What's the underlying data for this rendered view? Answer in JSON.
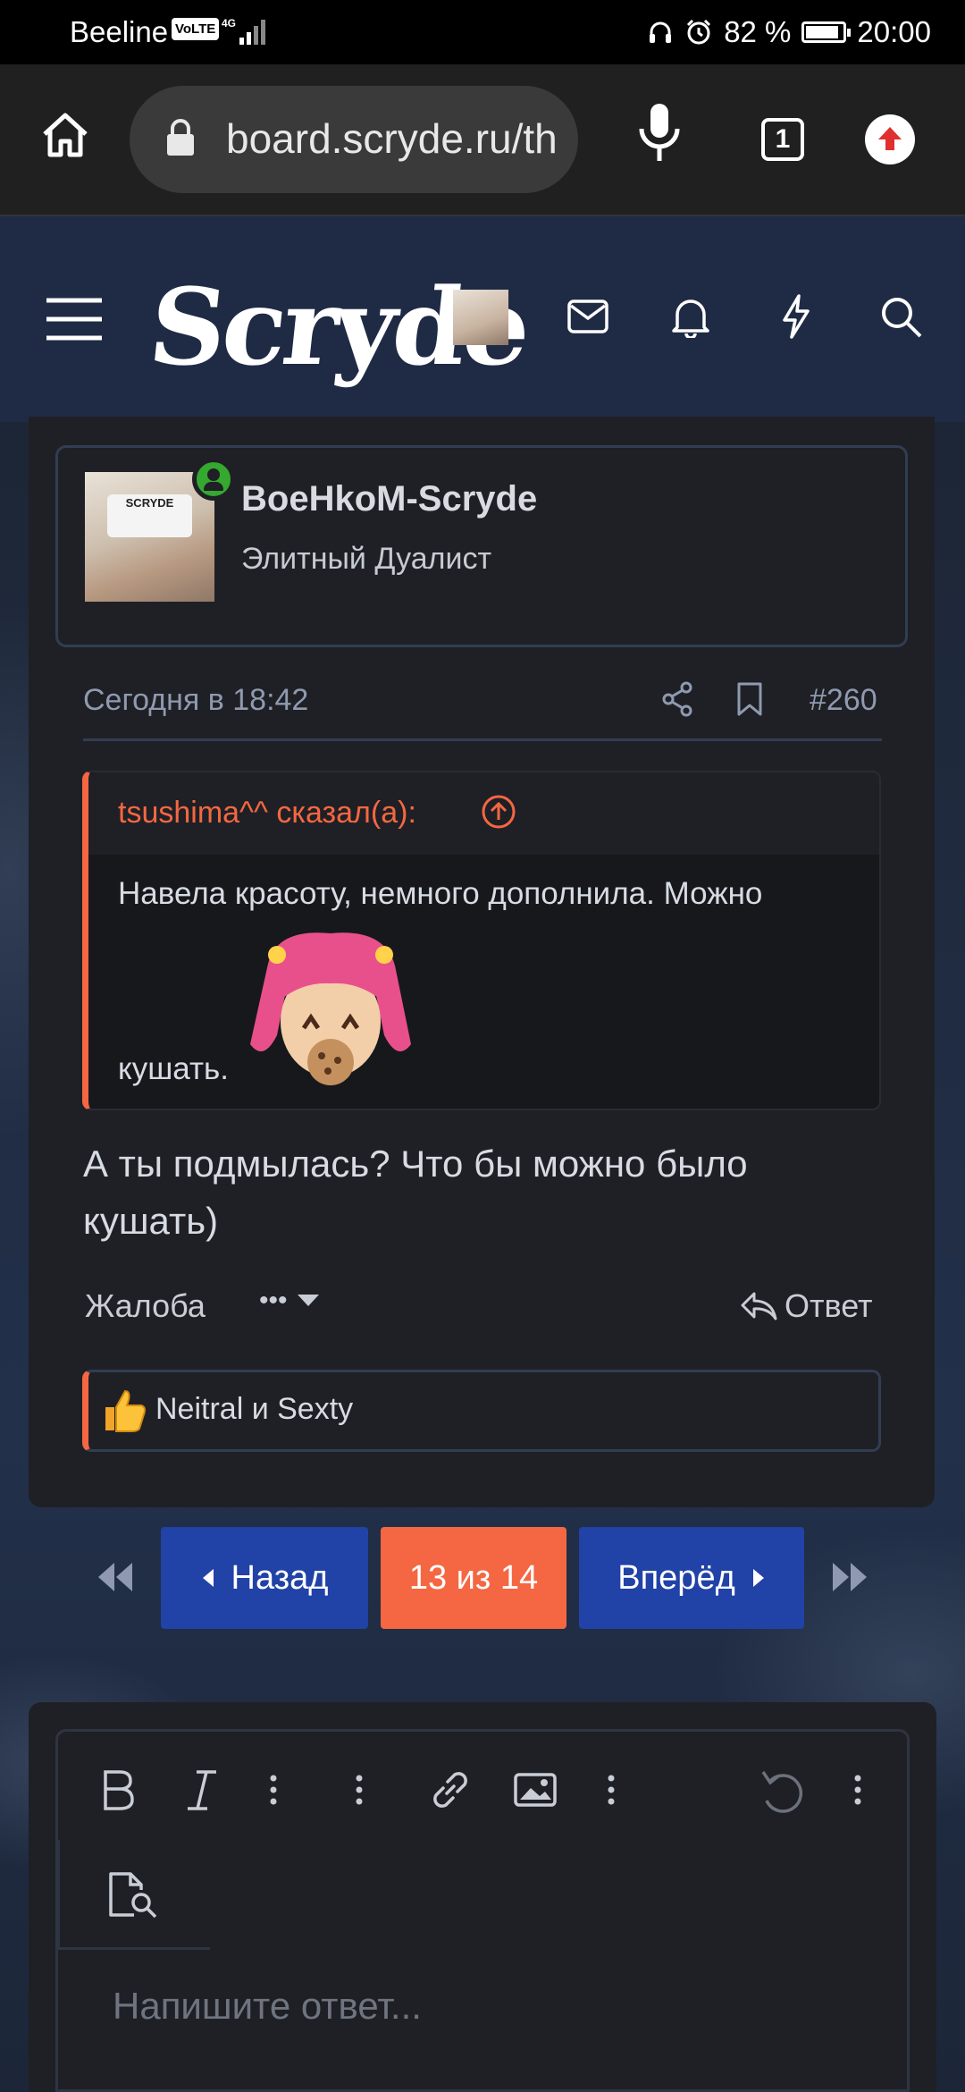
{
  "status_bar": {
    "carrier": "Beeline",
    "volte": "VoLTE",
    "network": "4G",
    "battery_text": "82 %",
    "battery_level": 0.82,
    "time": "20:00"
  },
  "browser": {
    "url": "board.scryde.ru/th",
    "tab_count": "1"
  },
  "site": {
    "logo": "Scryde"
  },
  "post": {
    "username": "BoeHkoM-Scryde",
    "user_title": "Элитный Дуалист",
    "avatar_shirt_text": "SCRYDE",
    "timestamp": "Сегодня в 18:42",
    "post_number": "#260",
    "quote": {
      "author_line": "tsushima^^ сказал(а):",
      "text_line1": "Навела красоту, немного дополнила. Можно",
      "text_line2": "кушать."
    },
    "body_line1": "А ты подмылась? Что бы можно было",
    "body_line2": "кушать)",
    "report_label": "Жалоба",
    "more_label": "•••",
    "reply_label": "Ответ",
    "reactions_text": "Neitral и Sexty"
  },
  "pagination": {
    "prev_label": "Назад",
    "current_label": "13 из 14",
    "next_label": "Вперёд"
  },
  "editor": {
    "placeholder": "Напишите ответ..."
  },
  "colors": {
    "accent": "#f46742",
    "nav_blue": "#2040a8",
    "header": "#1f2b45",
    "card": "#1f2025",
    "online": "#35a82f"
  }
}
